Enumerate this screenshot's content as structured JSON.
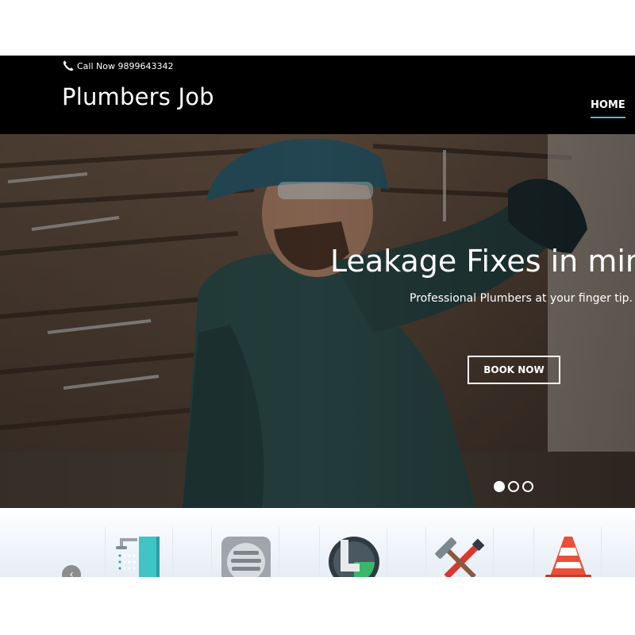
{
  "header": {
    "call_label": "Call Now 9899643342",
    "brand": "Plumbers Job",
    "nav": {
      "home": "HOME"
    }
  },
  "hero": {
    "title": "Leakage Fixes in min",
    "subtitle": "Professional Plumbers at your finger tip.",
    "cta": "BOOK NOW",
    "slides_total": 3,
    "active_slide": 1
  },
  "services": {
    "items": [
      {
        "icon": "shower-icon"
      },
      {
        "icon": "drain-grate-icon"
      },
      {
        "icon": "pipe-gauge-icon"
      },
      {
        "icon": "tools-icon"
      },
      {
        "icon": "traffic-cone-icon"
      }
    ]
  },
  "colors": {
    "header_bg": "#000000",
    "nav_underline": "#5bb6d8",
    "services_bg": "#e6edf6"
  }
}
